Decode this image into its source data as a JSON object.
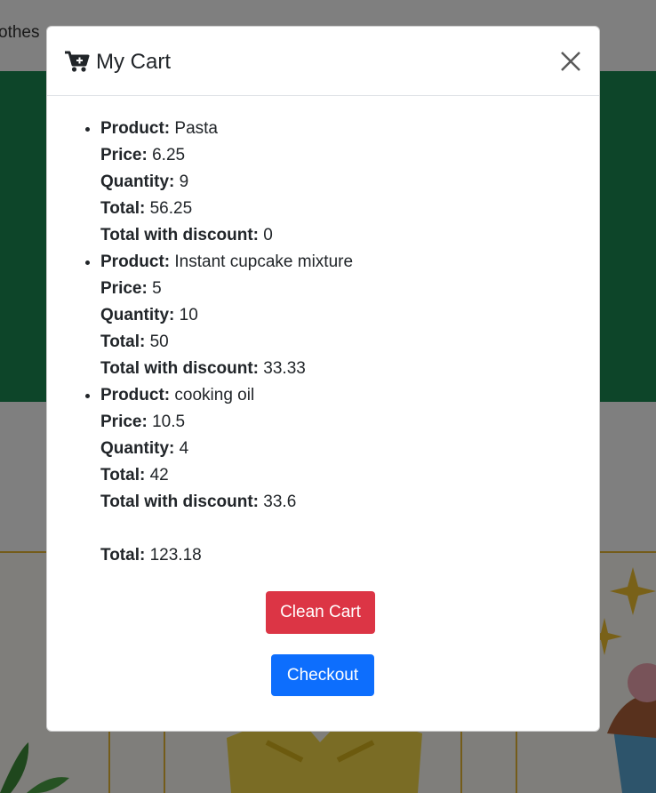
{
  "background": {
    "nav_fragment": "othes"
  },
  "modal": {
    "title": "My Cart",
    "icons": {
      "cart": "cart-plus-icon",
      "close": "close-icon"
    },
    "labels": {
      "product": "Product:",
      "price": "Price:",
      "quantity": "Quantity:",
      "total": "Total:",
      "total_with_discount": "Total with discount:"
    },
    "items": [
      {
        "product": "Pasta",
        "price": "6.25",
        "quantity": "9",
        "total": "56.25",
        "total_with_discount": "0"
      },
      {
        "product": "Instant cupcake mixture",
        "price": "5",
        "quantity": "10",
        "total": "50",
        "total_with_discount": "33.33"
      },
      {
        "product": "cooking oil",
        "price": "10.5",
        "quantity": "4",
        "total": "42",
        "total_with_discount": "33.6"
      }
    ],
    "grand_total_label": "Total:",
    "grand_total_value": "123.18",
    "clean_button": "Clean Cart",
    "checkout_button": "Checkout"
  },
  "colors": {
    "danger": "#dc3545",
    "primary": "#0d6efd",
    "banner": "#1b8a52"
  }
}
